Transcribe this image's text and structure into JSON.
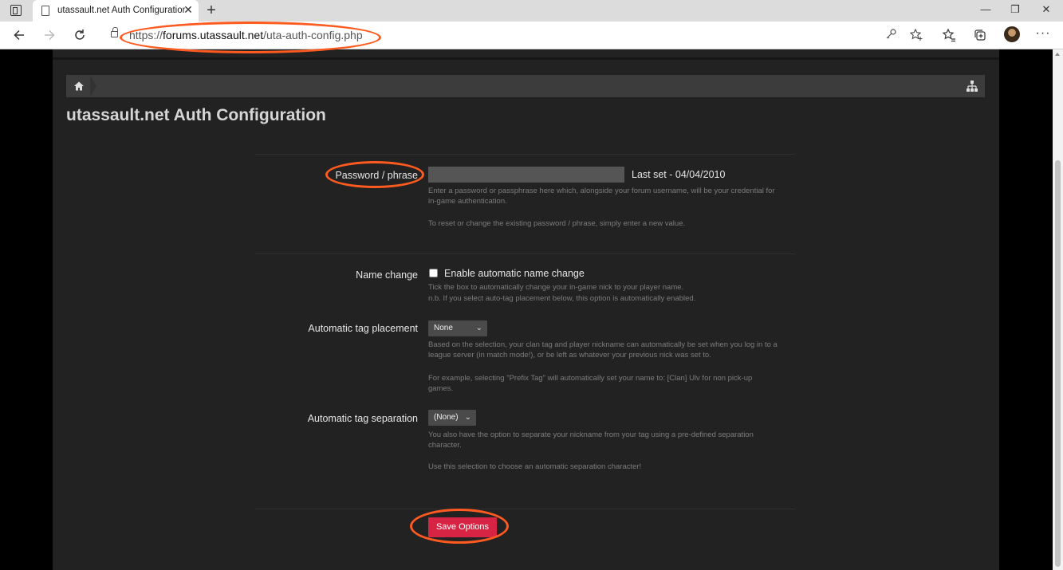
{
  "browser": {
    "tab_title": "utassault.net Auth Configuration",
    "tab_close": "✕",
    "new_tab": "+",
    "url_scheme": "https://",
    "url_host": "forums.utassault.net",
    "url_path": "/uta-auth-config.php",
    "window_minimize": "—",
    "window_restore": "❐",
    "window_close": "✕",
    "more": "···",
    "icons": [
      "tab-actions-icon",
      "page-icon",
      "back-icon",
      "forward-icon",
      "refresh-icon",
      "lock-icon",
      "key-icon",
      "favorite-add-icon",
      "favorites-icon",
      "collections-icon",
      "profile-avatar",
      "more-icon"
    ]
  },
  "breadcrumb": {
    "icons": [
      "home-icon",
      "sitemap-icon"
    ]
  },
  "page": {
    "title": "utassault.net Auth Configuration"
  },
  "form": {
    "password": {
      "label": "Password / phrase",
      "value": "",
      "last_set": "Last set - 04/04/2010",
      "help1": "Enter a password or passphrase here which, alongside your forum username, will be your credential for in-game authentication.",
      "help2": "To reset or change the existing password / phrase, simply enter a new value."
    },
    "name_change": {
      "label": "Name change",
      "checkbox_label": "Enable automatic name change",
      "checked": false,
      "help1": "Tick the box to automatically change your in-game nick to your player name.",
      "help2": "n.b. If you select auto-tag placement below, this option is automatically enabled."
    },
    "tag_placement": {
      "label": "Automatic tag placement",
      "selected": "None",
      "help1": "Based on the selection, your clan tag and player nickname can automatically be set when you log in to a league server (in match mode!), or be left as whatever your previous nick was set to.",
      "help2": "For example, selecting \"Prefix Tag\" will automatically set your name to: [Clan] Ulv for non pick-up games."
    },
    "tag_separation": {
      "label": "Automatic tag separation",
      "selected": "(None)",
      "help1": "You also have the option to separate your nickname from your tag using a pre-defined separation character.",
      "help2": "Use this selection to choose an automatic separation character!"
    },
    "save_label": "Save Options"
  },
  "colors": {
    "page_bg": "#222222",
    "breadcrumb_bg": "#3c3c3c",
    "save_button": "#d72444",
    "annotation": "#ff5a1f"
  }
}
